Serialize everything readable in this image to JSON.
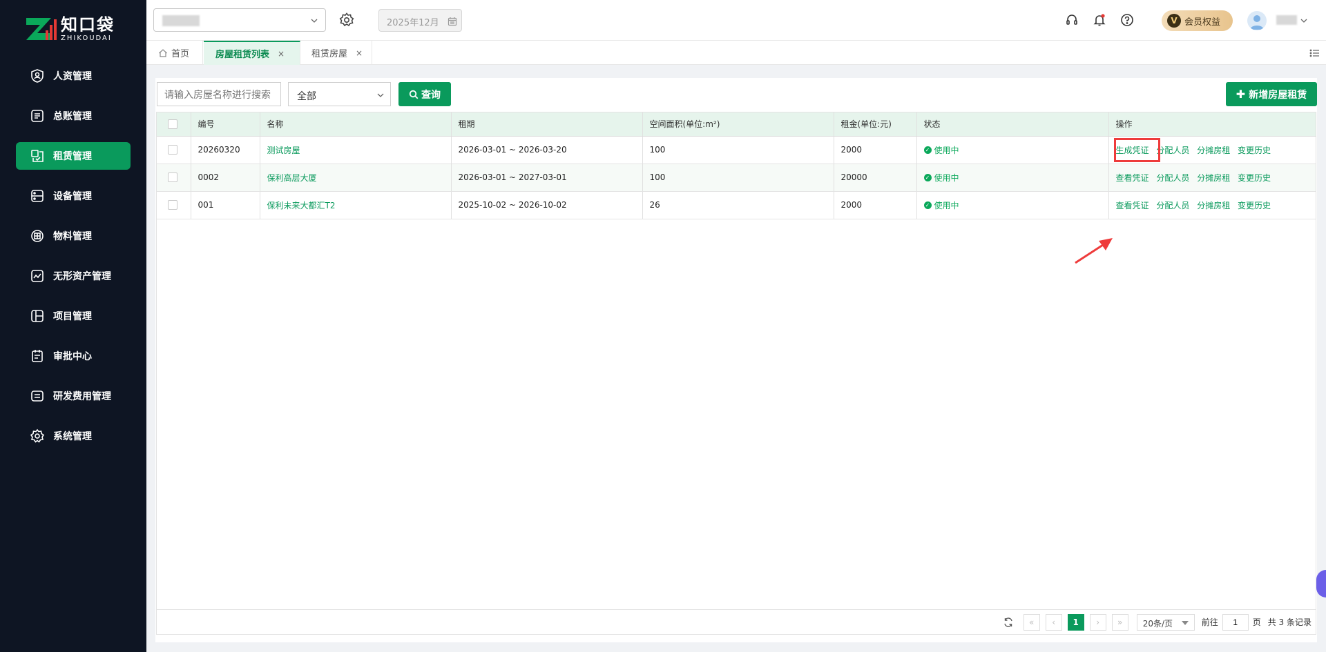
{
  "brand": {
    "name_cn": "知口袋",
    "name_en": "ZHIKOUDAI"
  },
  "sidebar": {
    "items": [
      {
        "label": "人资管理",
        "icon": "user-shield-icon"
      },
      {
        "label": "总账管理",
        "icon": "ledger-icon"
      },
      {
        "label": "租赁管理",
        "icon": "lease-icon",
        "active": true
      },
      {
        "label": "设备管理",
        "icon": "device-icon"
      },
      {
        "label": "物料管理",
        "icon": "material-icon"
      },
      {
        "label": "无形资产管理",
        "icon": "intangible-asset-icon"
      },
      {
        "label": "项目管理",
        "icon": "project-icon"
      },
      {
        "label": "审批中心",
        "icon": "approval-icon"
      },
      {
        "label": "研发费用管理",
        "icon": "rd-expense-icon"
      },
      {
        "label": "系统管理",
        "icon": "settings-icon"
      }
    ]
  },
  "header": {
    "month": "2025年12月",
    "vip_label": "会员权益",
    "vip_badge": "V"
  },
  "tabs": [
    {
      "label": "首页"
    },
    {
      "label": "房屋租赁列表",
      "close": "×"
    },
    {
      "label": "租赁房屋",
      "close": "×"
    }
  ],
  "toolbar": {
    "search_placeholder": "请输入房屋名称进行搜索",
    "status_value": "全部",
    "query_label": "查询",
    "add_label": "新增房屋租赁"
  },
  "table": {
    "columns": [
      "编号",
      "名称",
      "租期",
      "空间面积(单位:m²)",
      "租金(单位:元)",
      "状态",
      "操作"
    ],
    "rows": [
      {
        "id": "20260320",
        "name": "测试房屋",
        "period": "2026-03-01 ~ 2026-03-20",
        "area": "100",
        "rent": "2000",
        "status": "使用中",
        "actions": [
          "生成凭证",
          "分配人员",
          "分摊房租",
          "变更历史"
        ]
      },
      {
        "id": "0002",
        "name": "保利高层大厦",
        "period": "2026-03-01 ~ 2027-03-01",
        "area": "100",
        "rent": "20000",
        "status": "使用中",
        "actions": [
          "查看凭证",
          "分配人员",
          "分摊房租",
          "变更历史"
        ]
      },
      {
        "id": "001",
        "name": "保利未来大都汇T2",
        "period": "2025-10-02 ~ 2026-10-02",
        "area": "26",
        "rent": "2000",
        "status": "使用中",
        "actions": [
          "查看凭证",
          "分配人员",
          "分摊房租",
          "变更历史"
        ]
      }
    ]
  },
  "pagination": {
    "current_page": "1",
    "page_size": "20条/页",
    "goto_prefix": "前往",
    "goto_value": "1",
    "goto_suffix": "页",
    "total_text": "共 3 条记录"
  },
  "colors": {
    "accent": "#0a9a5c",
    "sidebar_bg": "#0e1523",
    "highlight": "#ee3b3b"
  }
}
